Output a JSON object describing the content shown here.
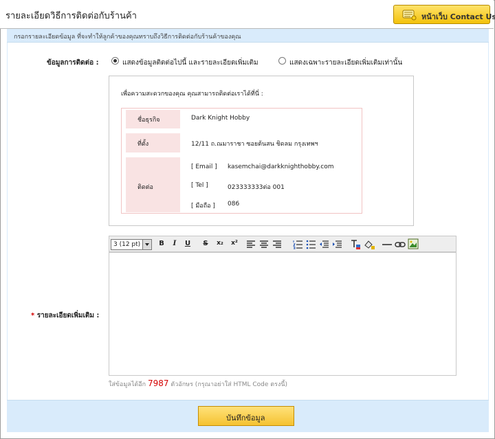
{
  "header": {
    "title": "รายละเอียดวิธีการติดต่อกับร้านค้า",
    "contact_button": "หน้าเว็บ Contact Us"
  },
  "description": "กรอกรายละเอียดข้อมูล ที่จะทำให้ลูกค้าของคุณทราบถึงวิธีการติดต่อกับร้านค้าของคุณ",
  "contact_section": {
    "label": "ข้อมูลการติดต่อ :",
    "option_1": "แสดงข้อมูลติดต่อไปนี้ และรายละเอียดเพิ่มเติม",
    "option_2": "แสดงเฉพาะรายละเอียดเพิ่มเติมเท่านั้น",
    "selected_option": "option_1"
  },
  "info": {
    "intro": "เพื่อความสะดวกของคุณ คุณสามารถติดต่อเราได้ที่นี่ :",
    "business_label": "ชื่อธุรกิจ",
    "business_value": "Dark Knight Hobby",
    "address_label": "ที่ตั้ง",
    "address_value": "12/11 ถ.ณมาราชา ซอยต้นสน ชิดลม กรุงเทพฯ",
    "contact_label": "ติดต่อ",
    "email_label": "[ Email ]",
    "email_value": "kasemchai@darkknighthobby.com",
    "tel_label": "[ Tel ]",
    "tel_value": "023333333ต่อ 001",
    "mobile_label": "[ มือถือ ]",
    "mobile_value": "086"
  },
  "editor": {
    "font_size": "3 (12 pt)",
    "tool_bold": "B",
    "tool_italic": "I",
    "tool_underline": "U",
    "tool_strike": "S",
    "tool_sub": "x₂",
    "tool_sup": "x²",
    "label": "รายละเอียดเพิ่มเติม :",
    "required_mark": "*",
    "counter_prefix": "ใส่ข้อมูลได้อีก",
    "counter_value": "7987",
    "counter_suffix": "ตัวอักษร (กรุณาอย่าใส่ HTML Code ตรงนี้)"
  },
  "footer": {
    "save_button": "บันทึกข้อมูล"
  }
}
